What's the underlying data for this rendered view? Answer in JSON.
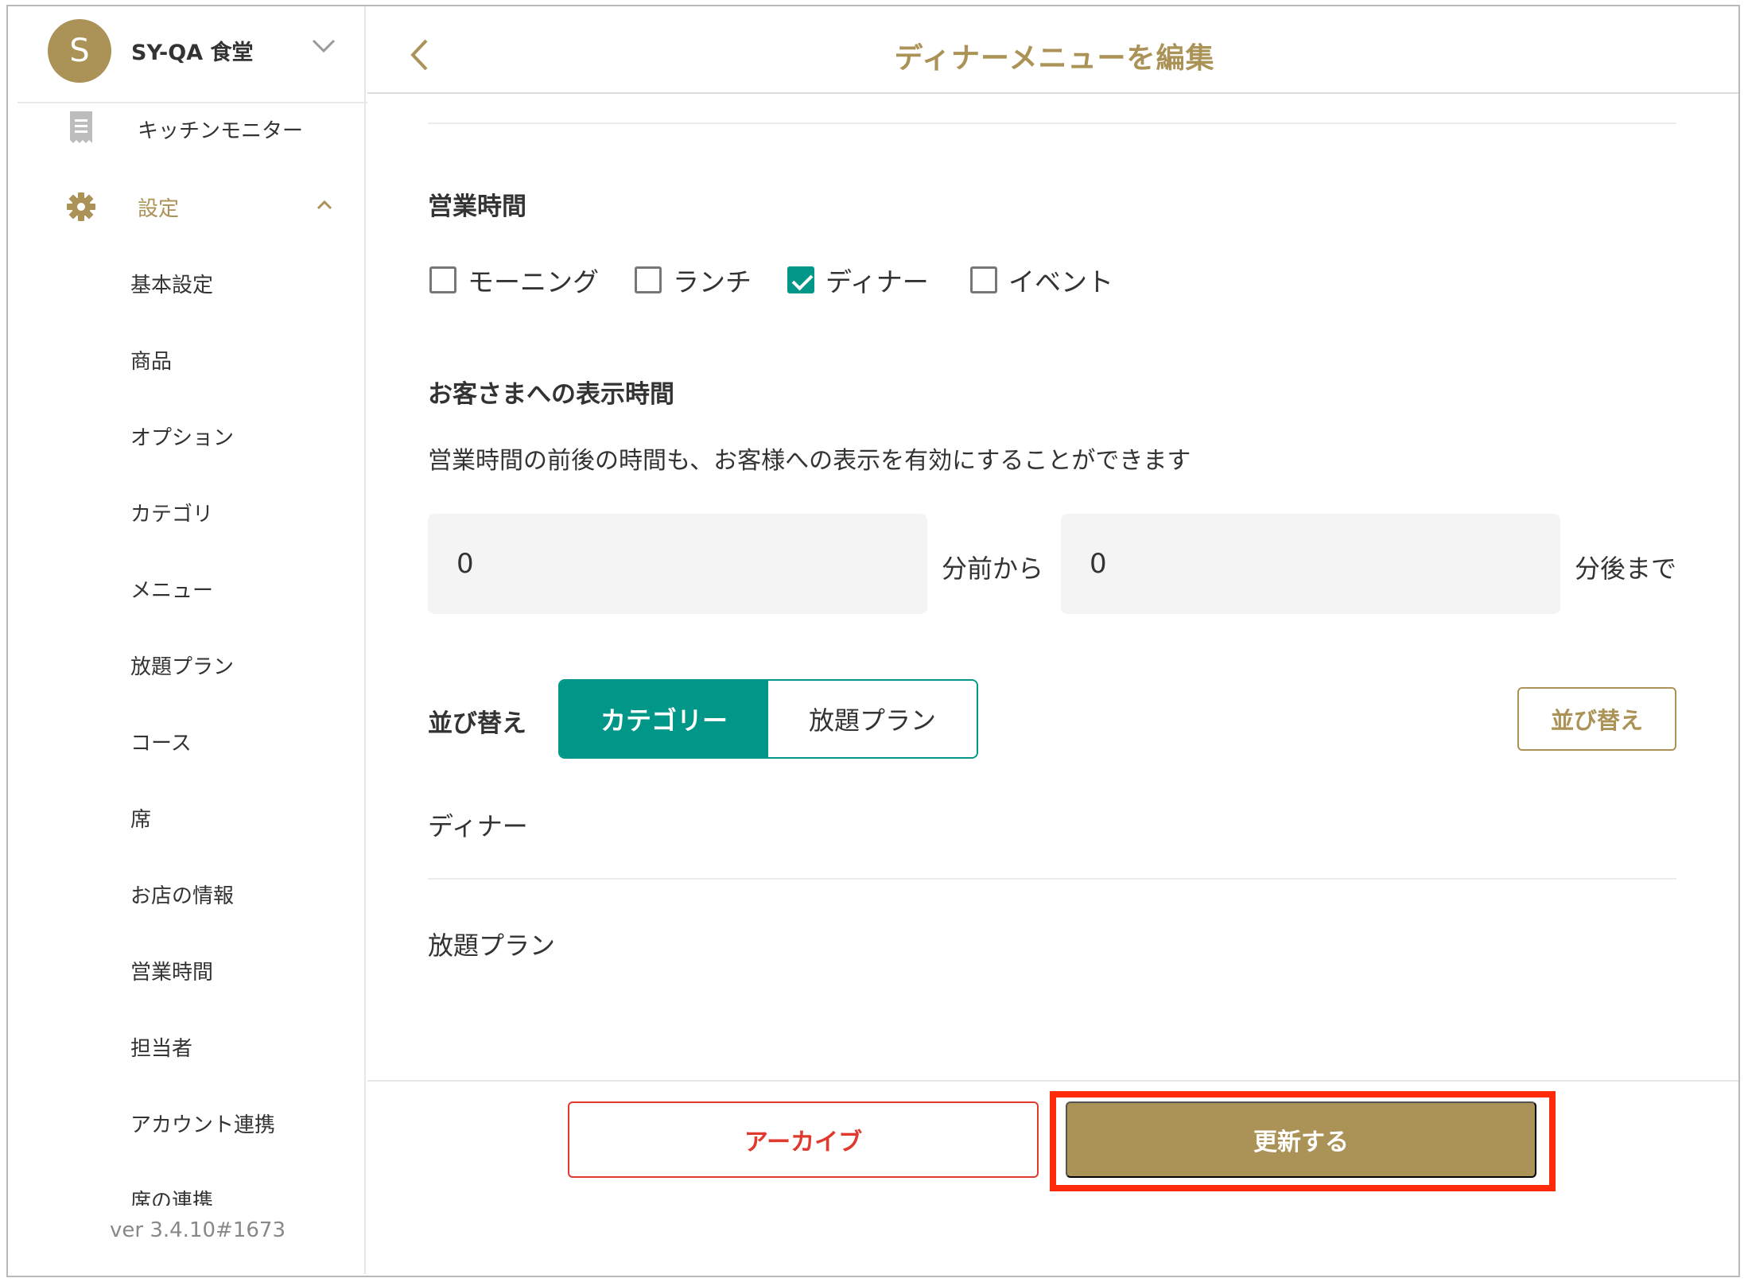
{
  "colors": {
    "brand": "#ab9257",
    "accent": "#009688",
    "danger": "#e03a2f",
    "highlight": "#ff2a0a"
  },
  "sidebar": {
    "avatar_letter": "S",
    "store_name": "SY-QA 食堂",
    "store_menu_icon": "chevron-down-icon",
    "kitchen_monitor": {
      "label": "キッチンモニター",
      "icon": "receipt-icon"
    },
    "settings": {
      "label": "設定",
      "icon": "gear-icon",
      "expanded": true
    },
    "sub_items": [
      "基本設定",
      "商品",
      "オプション",
      "カテゴリ",
      "メニュー",
      "放題プラン",
      "コース",
      "席",
      "お店の情報",
      "営業時間",
      "担当者",
      "アカウント連携",
      "席の連携"
    ],
    "version": "ver 3.4.10#1673"
  },
  "header": {
    "back_icon": "chevron-left-icon",
    "title": "ディナーメニューを編集"
  },
  "business_hours": {
    "title": "営業時間",
    "options": [
      {
        "label": "モーニング",
        "checked": false
      },
      {
        "label": "ランチ",
        "checked": false
      },
      {
        "label": "ディナー",
        "checked": true
      },
      {
        "label": "イベント",
        "checked": false
      }
    ]
  },
  "display_time": {
    "title": "お客さまへの表示時間",
    "description": "営業時間の前後の時間も、お客様への表示を有効にすることができます",
    "before_value": "0",
    "before_unit": "分前から",
    "after_value": "0",
    "after_unit": "分後まで"
  },
  "sort": {
    "label": "並び替え",
    "segments": [
      {
        "label": "カテゴリー",
        "selected": true
      },
      {
        "label": "放題プラン",
        "selected": false
      }
    ],
    "button": "並び替え",
    "items": [
      "ディナー",
      "放題プラン"
    ]
  },
  "footer": {
    "archive": "アーカイブ",
    "update": "更新する"
  }
}
